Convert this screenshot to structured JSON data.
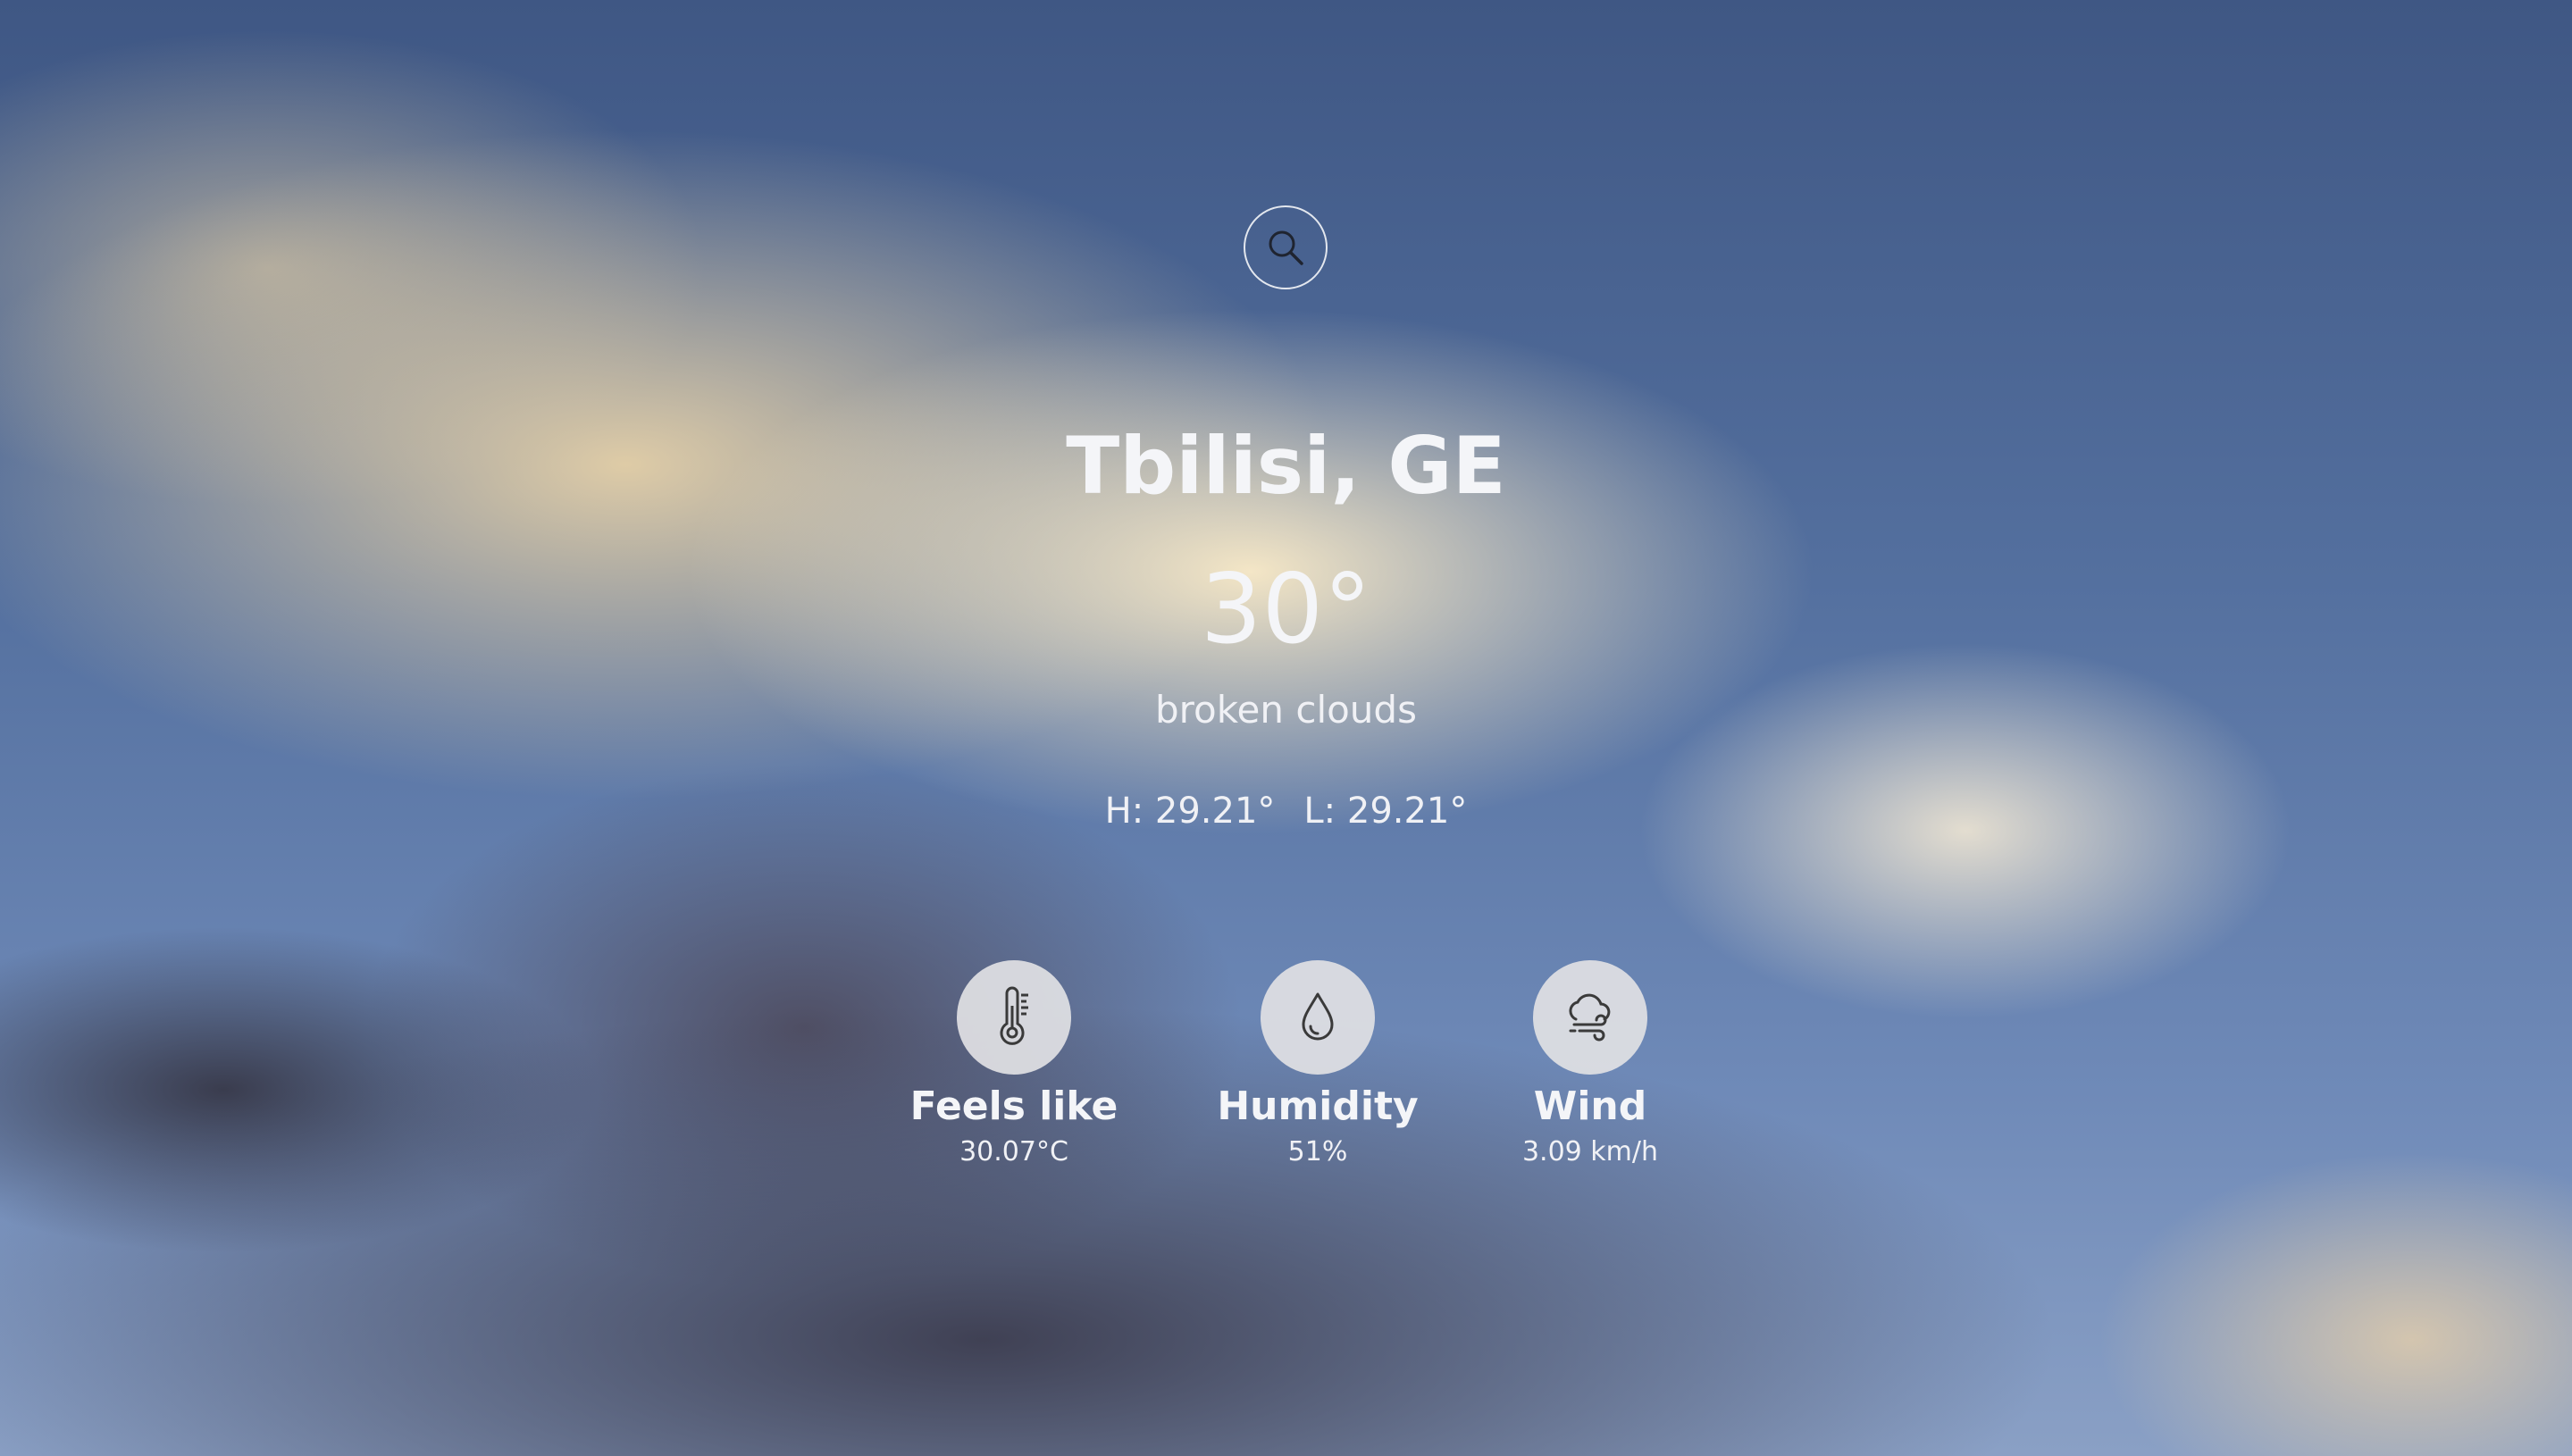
{
  "search": {
    "icon": "search-icon"
  },
  "location": {
    "name": "Tbilisi, GE"
  },
  "current": {
    "temperature": "30°",
    "description": "broken clouds",
    "high": "H: 29.21°",
    "low": "L: 29.21°"
  },
  "stats": {
    "feels_like": {
      "icon": "thermometer-icon",
      "label": "Feels like",
      "value": "30.07°C"
    },
    "humidity": {
      "icon": "water-drop-icon",
      "label": "Humidity",
      "value": "51%"
    },
    "wind": {
      "icon": "wind-cloud-icon",
      "label": "Wind",
      "value": "3.09 km/h"
    }
  },
  "colors": {
    "text": "#f4f5f8",
    "icon_circle": "#e1e1e4",
    "icon_stroke": "#3a3a3a",
    "sky_top": "#3f5784",
    "sky_bottom": "#8aa0c5"
  }
}
